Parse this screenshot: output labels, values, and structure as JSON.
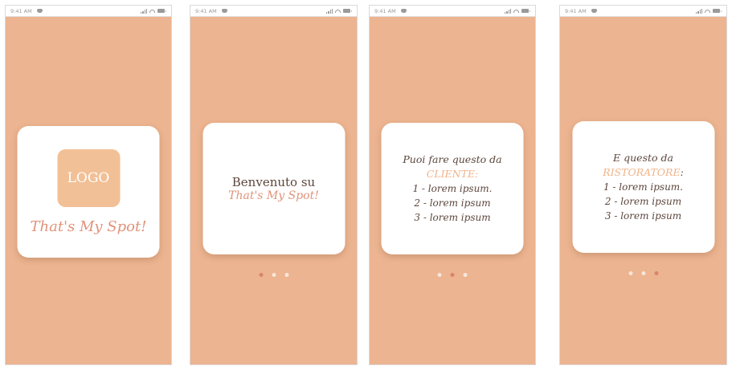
{
  "status_bar": {
    "time": "9:41 AM"
  },
  "screen1": {
    "logo_text": "LOGO",
    "app_name": "That's My Spot!"
  },
  "screen2": {
    "line1": "Benvenuto su",
    "line2": "That's My Spot!"
  },
  "screen3": {
    "intro": "Puoi fare questo da ",
    "role": "CLIENTE:",
    "items": [
      "1 - lorem ipsum.",
      "2 - lorem ipsum",
      "3 - lorem ipsum"
    ]
  },
  "screen4": {
    "intro": "E questo da ",
    "role": "RISTORATORE",
    "colon": ":",
    "items": [
      "1 - lorem ipsum.",
      "2 - lorem ipsum",
      "3 - lorem ipsum"
    ]
  },
  "pagination": {
    "screen2_active": 0,
    "screen3_active": 1,
    "screen4_active": 2,
    "count": 3
  },
  "colors": {
    "background": "#ecb490",
    "card": "#ffffff",
    "accent": "#e0937a",
    "logo": "#f2c096",
    "dot_active": "#d9846a"
  }
}
